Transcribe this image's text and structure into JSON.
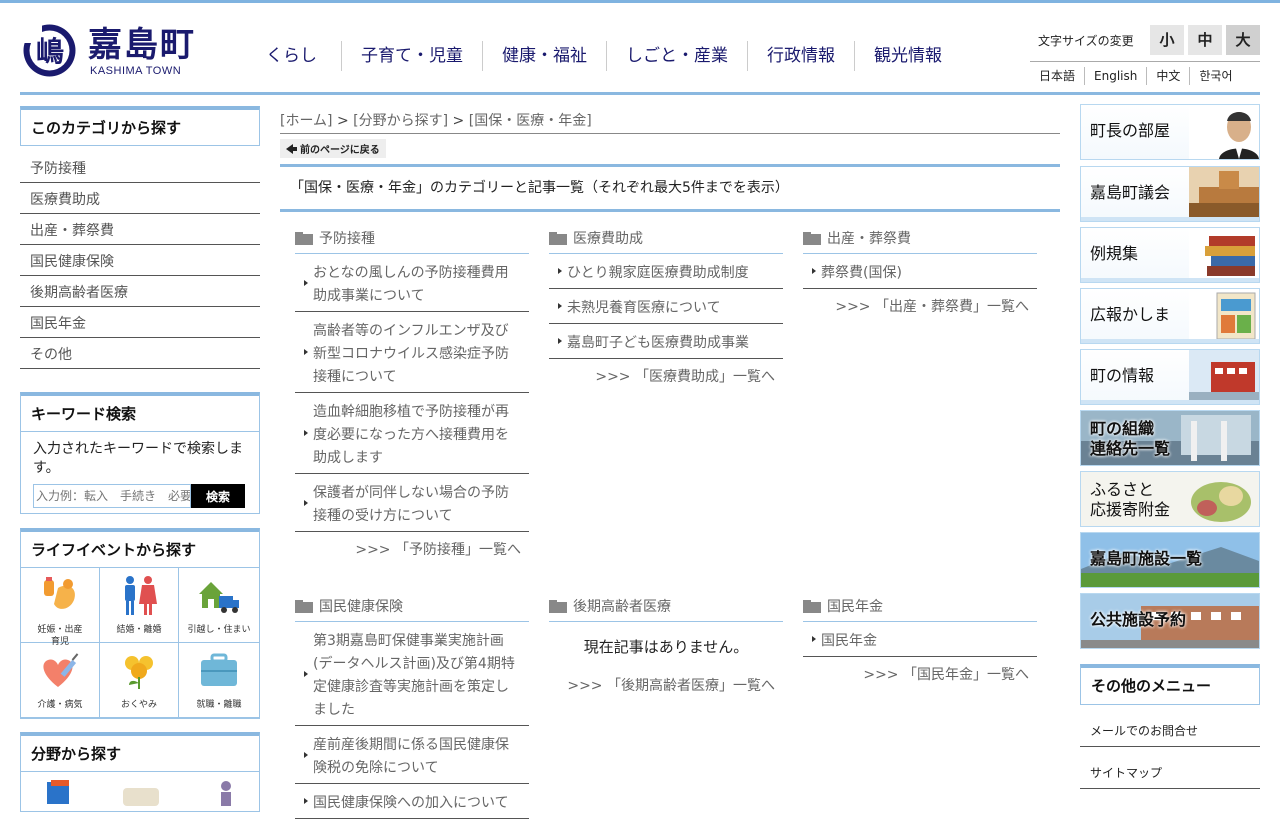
{
  "site": {
    "name": "嘉島町",
    "name_en": "KASHIMA TOWN",
    "logo_glyph": "嶋",
    "brand_color": "#1a1a6e",
    "accent_color": "#8ab8e0"
  },
  "gnav": [
    "くらし",
    "子育て・児童",
    "健康・福祉",
    "しごと・産業",
    "行政情報",
    "観光情報"
  ],
  "fontsize": {
    "label": "文字サイズの変更",
    "small": "小",
    "medium": "中",
    "large": "大"
  },
  "langs": [
    "日本語",
    "English",
    "中文",
    "한국어"
  ],
  "left": {
    "category_title": "このカテゴリから探す",
    "categories": [
      "予防接種",
      "医療費助成",
      "出産・葬祭費",
      "国民健康保険",
      "後期高齢者医療",
      "国民年金",
      "その他"
    ],
    "keyword": {
      "title": "キーワード検索",
      "desc": "入力されたキーワードで検索します。",
      "placeholder": "入力例：転入　手続き　必要",
      "button": "検索"
    },
    "life": {
      "title": "ライフイベントから探す",
      "items": [
        {
          "label": "妊娠・出産\n育児",
          "icon": "pregnancy-icon"
        },
        {
          "label": "結婚・離婚",
          "icon": "couple-icon"
        },
        {
          "label": "引越し・住まい",
          "icon": "moving-icon"
        },
        {
          "label": "介護・病気",
          "icon": "care-icon"
        },
        {
          "label": "おくやみ",
          "icon": "condolence-icon"
        },
        {
          "label": "就職・離職",
          "icon": "job-icon"
        }
      ]
    },
    "field_title": "分野から探す"
  },
  "main": {
    "breadcrumb": {
      "home": "[ホーム]",
      "sep": " > ",
      "field": "[分野から探す]",
      "current": "[国保・医療・年金]"
    },
    "back": "前のページに戻る",
    "heading": "「国保・医療・年金」のカテゴリーと記事一覧（それぞれ最大5件までを表示）",
    "sections": [
      {
        "title": "予防接種",
        "articles": [
          "おとなの風しんの予防接種費用助成事業について",
          "高齢者等のインフルエンザ及び新型コロナウイルス感染症予防接種について",
          "造血幹細胞移植で予防接種が再度必要になった方へ接種費用を助成します",
          "保護者が同伴しない場合の予防接種の受け方について"
        ],
        "more": ">>> 「予防接種」一覧へ"
      },
      {
        "title": "医療費助成",
        "articles": [
          "ひとり親家庭医療費助成制度",
          "未熟児養育医療について",
          "嘉島町子ども医療費助成事業"
        ],
        "more": ">>> 「医療費助成」一覧へ"
      },
      {
        "title": "出産・葬祭費",
        "articles": [
          "葬祭費(国保)"
        ],
        "more": ">>> 「出産・葬祭費」一覧へ"
      },
      {
        "title": "国民健康保険",
        "articles": [
          "第3期嘉島町保健事業実施計画(データヘルス計画)及び第4期特定健康診査等実施計画を策定しました",
          "産前産後期間に係る国民健康保険税の免除について",
          "国民健康保険への加入について"
        ],
        "more": ""
      },
      {
        "title": "後期高齢者医療",
        "articles": [],
        "empty": "現在記事はありません。",
        "more": ">>> 「後期高齢者医療」一覧へ"
      },
      {
        "title": "国民年金",
        "articles": [
          "国民年金"
        ],
        "more": ">>> 「国民年金」一覧へ"
      }
    ]
  },
  "right": {
    "banners": [
      {
        "label": "町長の部屋",
        "icon": "mayor-photo-icon"
      },
      {
        "label": "嘉島町議会",
        "icon": "assembly-photo-icon"
      },
      {
        "label": "例規集",
        "icon": "books-photo-icon"
      },
      {
        "label": "広報かしま",
        "icon": "magazine-photo-icon"
      },
      {
        "label": "町の情報",
        "icon": "building-photo-icon"
      },
      {
        "label": "町の組織\n連絡先一覧",
        "icon": "office-photo-icon"
      },
      {
        "label": "ふるさと\n応援寄附金",
        "icon": "food-photo-icon"
      },
      {
        "label": "嘉島町施設一覧",
        "icon": "landscape-photo-icon"
      },
      {
        "label": "公共施設予約",
        "icon": "facility-photo-icon"
      }
    ],
    "other": {
      "title": "その他のメニュー",
      "items": [
        "メールでのお問合せ",
        "サイトマップ"
      ]
    }
  }
}
